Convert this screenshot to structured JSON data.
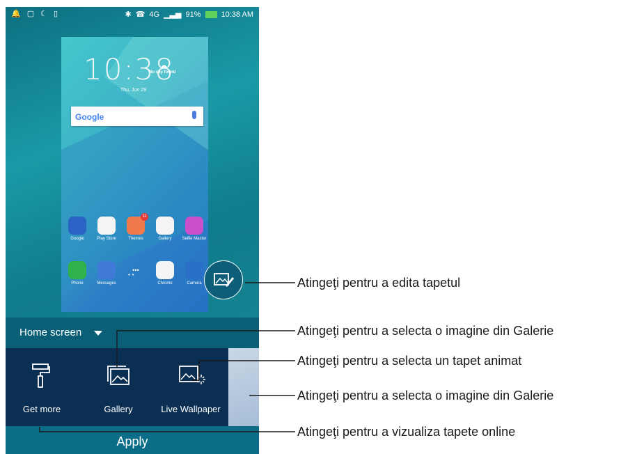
{
  "status_bar": {
    "network": "4G",
    "battery_percent": "91%",
    "time": "10:38 AM"
  },
  "preview": {
    "clock": "10:38",
    "weather": "No city found",
    "date": "Thu, Jun 29",
    "search_logo": "Google",
    "apps_row1": [
      {
        "label": "Google",
        "icon": "google-folder-icon",
        "color": "#2a63c4"
      },
      {
        "label": "Play Store",
        "icon": "play-store-icon",
        "color": "#f4f4f4"
      },
      {
        "label": "Themes",
        "icon": "themes-icon",
        "color": "#f07a4c",
        "badge": "11"
      },
      {
        "label": "Gallery",
        "icon": "gallery-icon",
        "color": "#f4f4f4"
      },
      {
        "label": "Selfie Master",
        "icon": "selfie-master-icon",
        "color": "#c94fcb"
      }
    ],
    "apps_row2": [
      {
        "label": "Phone",
        "icon": "phone-icon",
        "color": "#2fb24a"
      },
      {
        "label": "Messages",
        "icon": "messages-icon",
        "color": "#3f7ad9"
      },
      {
        "label": "",
        "icon": "app-drawer-icon",
        "color": "transparent"
      },
      {
        "label": "Chrome",
        "icon": "chrome-icon",
        "color": "#f4f4f4"
      },
      {
        "label": "Camera",
        "icon": "camera-icon",
        "color": "#2a6fc8"
      }
    ]
  },
  "home_selector": "Home screen",
  "tray": [
    {
      "label": "Get more",
      "icon": "paint-roller-icon"
    },
    {
      "label": "Gallery",
      "icon": "gallery-images-icon"
    },
    {
      "label": "Live Wallpaper",
      "icon": "live-wallpaper-icon"
    }
  ],
  "apply_label": "Apply",
  "callouts": [
    "Atingeţi pentru a edita tapetul",
    "Atingeţi pentru a selecta o imagine din Galerie",
    "Atingeţi pentru a selecta un tapet animat",
    "Atingeţi pentru a selecta o imagine din Galerie",
    "Atingeţi pentru a vizualiza tapete online"
  ]
}
